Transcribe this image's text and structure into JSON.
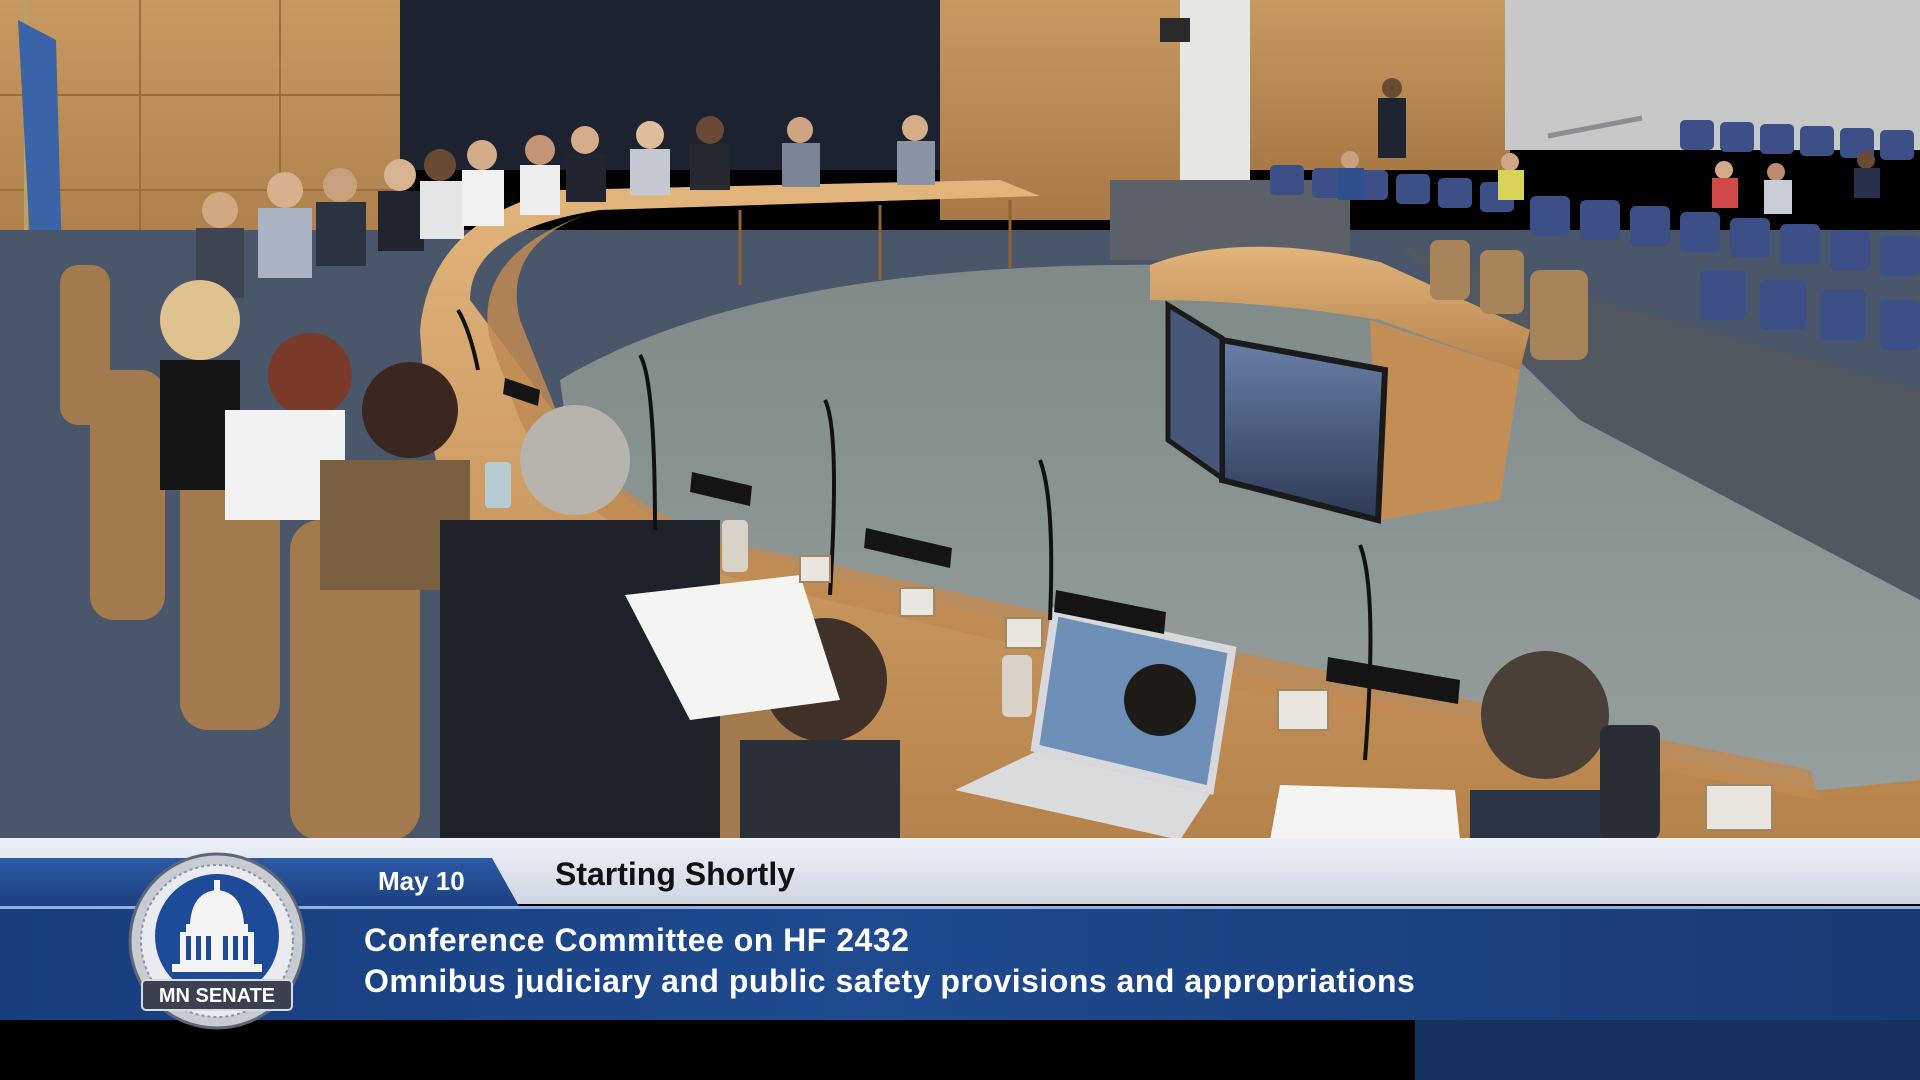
{
  "broadcast": {
    "date": "May 10",
    "status": "Starting Shortly",
    "title": "Conference Committee on HF 2432",
    "subtitle": "Omnibus judiciary and public safety provisions and appropriations"
  },
  "logo": {
    "text": "MN SENATE"
  },
  "colors": {
    "band_blue": "#1f4a8f",
    "date_tab_blue": "#2c5aa6",
    "desk_wood": "#c99a62",
    "carpet_gray": "#8d9795",
    "chair_blue": "#3c4f86"
  }
}
